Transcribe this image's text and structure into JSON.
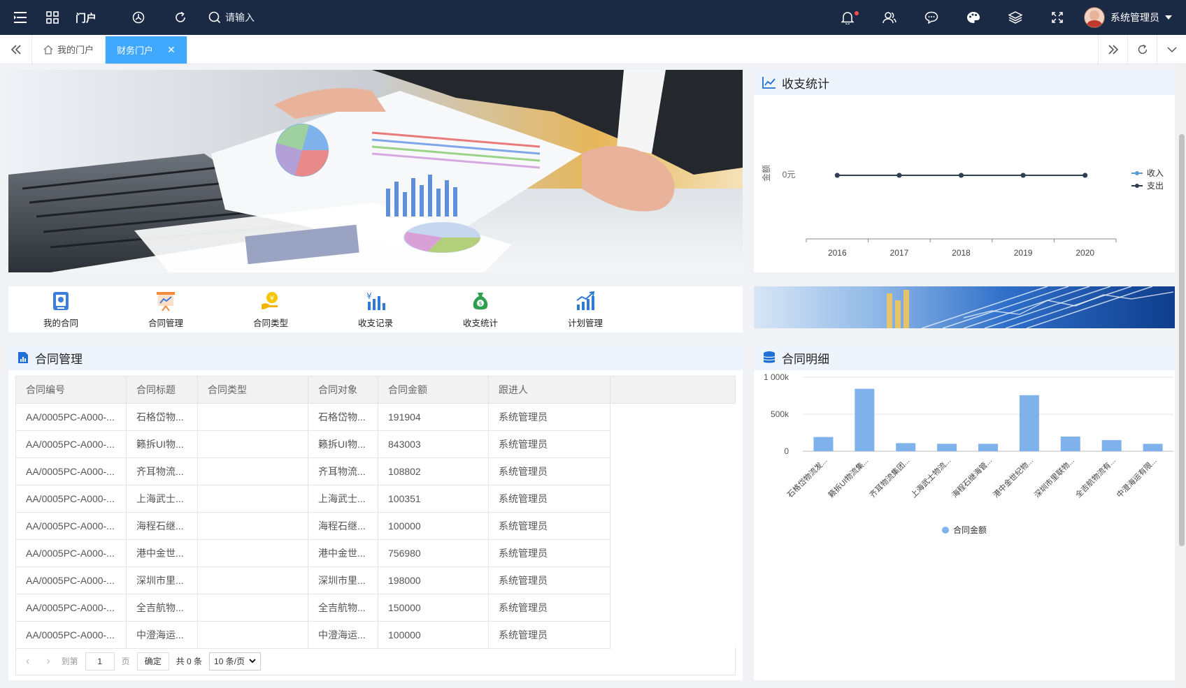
{
  "topbar": {
    "portal_label": "门户",
    "search_placeholder": "请输入",
    "user_name": "系统管理员"
  },
  "tabs": [
    {
      "label": "我的门户"
    },
    {
      "label": "财务门户"
    }
  ],
  "shortcuts": [
    {
      "label": "我的合同",
      "icon": "contract-icon"
    },
    {
      "label": "合同管理",
      "icon": "presentation-icon"
    },
    {
      "label": "合同类型",
      "icon": "money-hand-icon"
    },
    {
      "label": "收支记录",
      "icon": "yen-bars-icon"
    },
    {
      "label": "收支统计",
      "icon": "money-bag-icon"
    },
    {
      "label": "计划管理",
      "icon": "growth-chart-icon"
    }
  ],
  "stats": {
    "title": "收支统计",
    "ylabel": "金额",
    "ytick": "0元",
    "legend": [
      "收入",
      "支出"
    ]
  },
  "contract": {
    "title": "合同管理",
    "columns": [
      "合同编号",
      "合同标题",
      "合同类型",
      "合同对象",
      "合同金额",
      "跟进人"
    ],
    "rows": [
      [
        "AA/0005PC-A000-...",
        "石格岱物...",
        "",
        "石格岱物...",
        "191904",
        "系统管理员"
      ],
      [
        "AA/0005PC-A000-...",
        "籁拆UI物...",
        "",
        "籁拆UI物...",
        "843003",
        "系统管理员"
      ],
      [
        "AA/0005PC-A000-...",
        "齐耳物流...",
        "",
        "齐耳物流...",
        "108802",
        "系统管理员"
      ],
      [
        "AA/0005PC-A000-...",
        "上海武士...",
        "",
        "上海武士...",
        "100351",
        "系统管理员"
      ],
      [
        "AA/0005PC-A000-...",
        "海程石继...",
        "",
        "海程石继...",
        "100000",
        "系统管理员"
      ],
      [
        "AA/0005PC-A000-...",
        "港中金世...",
        "",
        "港中金世...",
        "756980",
        "系统管理员"
      ],
      [
        "AA/0005PC-A000-...",
        "深圳市里...",
        "",
        "深圳市里...",
        "198000",
        "系统管理员"
      ],
      [
        "AA/0005PC-A000-...",
        "全吉航物...",
        "",
        "全吉航物...",
        "150000",
        "系统管理员"
      ],
      [
        "AA/0005PC-A000-...",
        "中澄海运...",
        "",
        "中澄海运...",
        "100000",
        "系统管理员"
      ]
    ],
    "pager": {
      "goto": "到第",
      "page": "1",
      "page_unit": "页",
      "confirm": "确定",
      "total": "共 0 条",
      "page_size": "10 条/页"
    }
  },
  "detail": {
    "title": "合同明细"
  },
  "chart_data": [
    {
      "type": "line",
      "title": "收支统计",
      "ylabel": "金额",
      "x": [
        "2016",
        "2017",
        "2018",
        "2019",
        "2020"
      ],
      "series": [
        {
          "name": "收入",
          "values": [
            0,
            0,
            0,
            0,
            0
          ],
          "color": "#5b9bd5"
        },
        {
          "name": "支出",
          "values": [
            0,
            0,
            0,
            0,
            0
          ],
          "color": "#2f3e50"
        }
      ],
      "ytick_labels": [
        "0元"
      ],
      "legend": "right"
    },
    {
      "type": "bar",
      "title": "合同明细",
      "categories": [
        "石格岱物流发...",
        "籁拆UI物流集...",
        "齐耳物流集团...",
        "上海武士物流...",
        "海程石继海管...",
        "港中金世纪物...",
        "深圳市里联物...",
        "全吉航物流有...",
        "中澄海运有限..."
      ],
      "series": [
        {
          "name": "合同金额",
          "values": [
            191904,
            843003,
            108802,
            100351,
            100000,
            756980,
            198000,
            150000,
            100000
          ],
          "color": "#7fb2ea"
        }
      ],
      "ylim": [
        0,
        1000000
      ],
      "ytick_labels": [
        "1 000k",
        "500k",
        "0"
      ],
      "legend": "bottom",
      "grid": true
    }
  ]
}
